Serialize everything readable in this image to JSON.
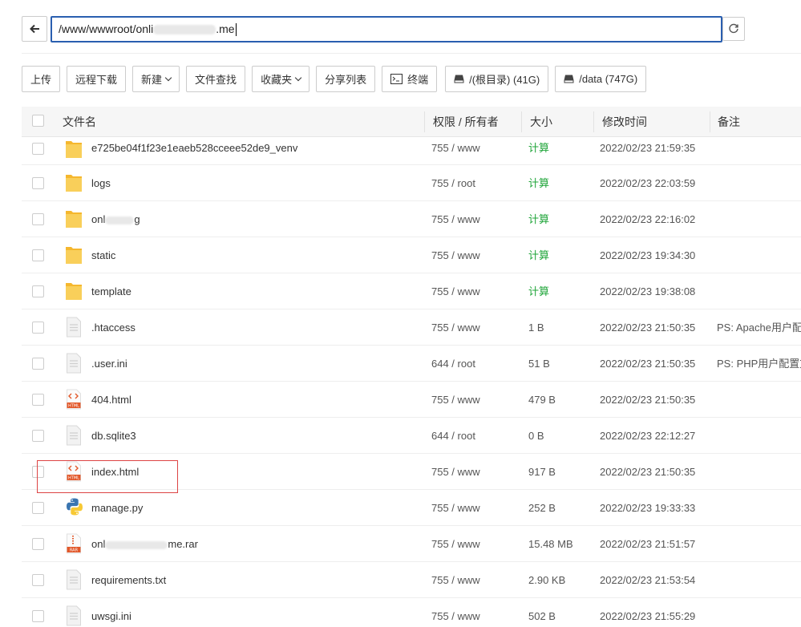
{
  "address": {
    "path_prefix": "/www/wwwroot/onli",
    "path_suffix": ".me"
  },
  "toolbar": {
    "upload": "上传",
    "remote_download": "远程下载",
    "new": "新建",
    "find": "文件查找",
    "favorites": "收藏夹",
    "share_list": "分享列表",
    "terminal": "终端",
    "disk_root": "/(根目录) (41G)",
    "disk_data": "/data (747G)"
  },
  "table": {
    "headers": {
      "name": "文件名",
      "perm": "权限 / 所有者",
      "size": "大小",
      "mtime": "修改时间",
      "note": "备注"
    },
    "rows": [
      {
        "name": "e725be04f1f23e1eaeb528cceee52de9_venv",
        "perm": "755 / www",
        "size": "计算",
        "mtime": "2022/02/23 21:59:35",
        "note": "",
        "type": "folder"
      },
      {
        "name": "logs",
        "perm": "755 / root",
        "size": "计算",
        "mtime": "2022/02/23 22:03:59",
        "note": "",
        "type": "folder"
      },
      {
        "name": "onl",
        "name_tail": "g",
        "perm": "755 / www",
        "size": "计算",
        "mtime": "2022/02/23 22:16:02",
        "note": "",
        "type": "folder"
      },
      {
        "name": "static",
        "perm": "755 / www",
        "size": "计算",
        "mtime": "2022/02/23 19:34:30",
        "note": "",
        "type": "folder"
      },
      {
        "name": "template",
        "perm": "755 / www",
        "size": "计算",
        "mtime": "2022/02/23 19:38:08",
        "note": "",
        "type": "folder"
      },
      {
        "name": ".htaccess",
        "perm": "755 / www",
        "size": "1 B",
        "mtime": "2022/02/23 21:50:35",
        "note": "PS: Apache用户配置",
        "type": "file"
      },
      {
        "name": ".user.ini",
        "perm": "644 / root",
        "size": "51 B",
        "mtime": "2022/02/23 21:50:35",
        "note": "PS: PHP用户配置文",
        "type": "file"
      },
      {
        "name": "404.html",
        "perm": "755 / www",
        "size": "479 B",
        "mtime": "2022/02/23 21:50:35",
        "note": "",
        "type": "html"
      },
      {
        "name": "db.sqlite3",
        "perm": "644 / root",
        "size": "0 B",
        "mtime": "2022/02/23 22:12:27",
        "note": "",
        "type": "file"
      },
      {
        "name": "index.html",
        "perm": "755 / www",
        "size": "917 B",
        "mtime": "2022/02/23 21:50:35",
        "note": "",
        "type": "html"
      },
      {
        "name": "manage.py",
        "perm": "755 / www",
        "size": "252 B",
        "mtime": "2022/02/23 19:33:33",
        "note": "",
        "type": "python"
      },
      {
        "name": "onl",
        "name_tail": "me.rar",
        "perm": "755 / www",
        "size": "15.48 MB",
        "mtime": "2022/02/23 21:51:57",
        "note": "",
        "type": "rar"
      },
      {
        "name": "requirements.txt",
        "perm": "755 / www",
        "size": "2.90 KB",
        "mtime": "2022/02/23 21:53:54",
        "note": "",
        "type": "file"
      },
      {
        "name": "uwsgi.ini",
        "perm": "755 / www",
        "size": "502 B",
        "mtime": "2022/02/23 21:55:29",
        "note": "",
        "type": "file"
      }
    ]
  },
  "colors": {
    "accent": "#2a5fb0",
    "calc_green": "#20a53a",
    "folder": "#f8c64a",
    "highlight": "#dd4444"
  }
}
